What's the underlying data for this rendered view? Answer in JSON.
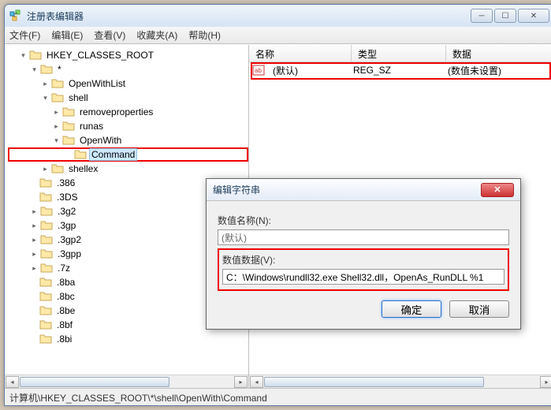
{
  "window": {
    "title": "注册表编辑器"
  },
  "menu": {
    "file": "文件(F)",
    "edit": "编辑(E)",
    "view": "查看(V)",
    "favorites": "收藏夹(A)",
    "help": "帮助(H)"
  },
  "tree": {
    "root": "HKEY_CLASSES_ROOT",
    "star": "*",
    "openwithlist": "OpenWithList",
    "shell": "shell",
    "removeproperties": "removeproperties",
    "runas": "runas",
    "openwith": "OpenWith",
    "command": "Command",
    "shellex": "shellex",
    "ext_386": ".386",
    "ext_3ds": ".3DS",
    "ext_3g2": ".3g2",
    "ext_3gp": ".3gp",
    "ext_3gp2": ".3gp2",
    "ext_3gpp": ".3gpp",
    "ext_7z": ".7z",
    "ext_8ba": ".8ba",
    "ext_8bc": ".8bc",
    "ext_8be": ".8be",
    "ext_8bf": ".8bf",
    "ext_8bi": ".8bi"
  },
  "list": {
    "cols": {
      "name": "名称",
      "type": "类型",
      "data": "数据"
    },
    "row": {
      "name": "(默认)",
      "type": "REG_SZ",
      "data": "(数值未设置)"
    }
  },
  "dialog": {
    "title": "编辑字符串",
    "name_label": "数值名称(N):",
    "name_value": "(默认)",
    "data_label": "数值数据(V):",
    "data_value": "C：\\Windows\\rundll32.exe Shell32.dll，OpenAs_RunDLL %1",
    "ok": "确定",
    "cancel": "取消"
  },
  "statusbar": "计算机\\HKEY_CLASSES_ROOT\\*\\shell\\OpenWith\\Command"
}
